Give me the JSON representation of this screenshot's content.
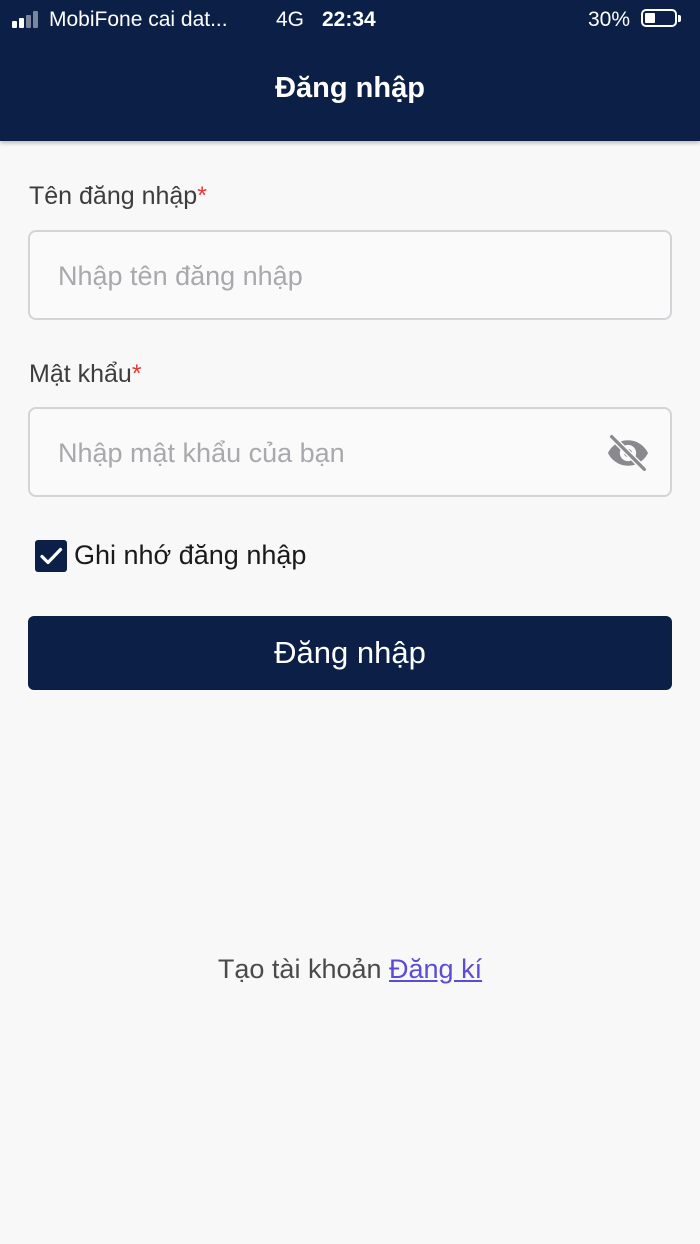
{
  "status_bar": {
    "carrier": "MobiFone cai dat...",
    "network": "4G",
    "time": "22:34",
    "battery": "30%",
    "battery_level": 0.3,
    "signal_bars": 2
  },
  "header": {
    "title": "Đăng nhập"
  },
  "form": {
    "username": {
      "label": "Tên đăng nhập",
      "required_mark": "*",
      "placeholder": "Nhập tên đăng nhập",
      "value": ""
    },
    "password": {
      "label": "Mật khẩu",
      "required_mark": "*",
      "placeholder": "Nhập mật khẩu của bạn",
      "value": "",
      "toggle_icon": "eye-off-icon"
    },
    "remember": {
      "label": "Ghi nhớ đăng nhập",
      "checked": true
    },
    "submit_label": "Đăng nhập"
  },
  "footer": {
    "prompt": "Tạo tài khoản",
    "register_link": "Đăng kí"
  },
  "colors": {
    "primary": "#0b1f47",
    "required": "#e53935",
    "link": "#5b4bd6",
    "placeholder": "#a9a9ad",
    "border": "#d4d4d8",
    "background": "#f8f8f8"
  }
}
